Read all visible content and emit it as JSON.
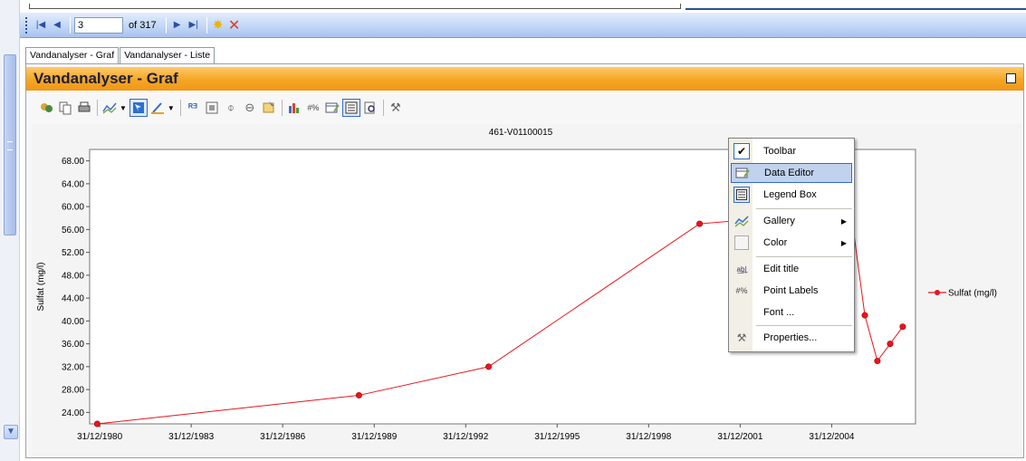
{
  "navigator": {
    "current_record": "3",
    "of_label": "of 317",
    "icons": [
      "move-first-icon",
      "move-previous-icon",
      "move-next-icon",
      "move-last-icon",
      "add-new-icon",
      "delete-icon"
    ]
  },
  "tabs": [
    {
      "label": "Vandanalyser - Graf",
      "active": true
    },
    {
      "label": "Vandanalyser - Liste",
      "active": false
    }
  ],
  "panel": {
    "title": "Vandanalyser - Graf"
  },
  "chart_toolbar_icons": [
    "copy-to-clipboard-icon",
    "copy-icon",
    "print-icon",
    "gallery-icon",
    "color-icon",
    "palette-icon",
    "zoom-icon",
    "grid-icon",
    "vertical-grid-icon",
    "horizontal-grid-icon",
    "export-icon",
    "axis-icon",
    "point-labels-icon",
    "data-editor-icon",
    "legend-box-icon",
    "magnify-icon",
    "properties-icon"
  ],
  "chart_data": {
    "type": "line",
    "title": "461-V01100015",
    "ylabel": "Sulfat (mg/l)",
    "xlabel": "",
    "ylim": [
      22,
      70
    ],
    "yticks": [
      "68.00",
      "64.00",
      "60.00",
      "56.00",
      "52.00",
      "48.00",
      "44.00",
      "40.00",
      "36.00",
      "32.00",
      "28.00",
      "24.00"
    ],
    "xticks": [
      "31/12/1980",
      "31/12/1983",
      "31/12/1986",
      "31/12/1989",
      "31/12/1992",
      "31/12/1995",
      "31/12/1998",
      "31/12/2001",
      "31/12/2004"
    ],
    "grid": false,
    "legend_position": "right",
    "series": [
      {
        "name": "Sulfat (mg/l)",
        "color": "#e8141c",
        "x": [
          "1980-12-01",
          "1989-07-01",
          "1993-10-01",
          "2000-09-01",
          "2001-11-01",
          "2004-06-01",
          "2005-08-01",
          "2006-02-01",
          "2006-07-01",
          "2006-12-01",
          "2007-05-01"
        ],
        "y": [
          22.0,
          27.0,
          32.0,
          57.0,
          57.5,
          69.0,
          61.0,
          41.0,
          33.0,
          36.0,
          39.0
        ]
      }
    ]
  },
  "context_menu": {
    "items": [
      {
        "label": "Toolbar",
        "icon": "check-icon"
      },
      {
        "label": "Data Editor",
        "icon": "data-editor-icon",
        "highlighted": true
      },
      {
        "label": "Legend Box",
        "icon": "legend-box-icon"
      },
      {
        "label": "Gallery",
        "icon": "gallery-icon",
        "submenu": true
      },
      {
        "label": "Color",
        "icon": "color-icon",
        "submenu": true
      },
      {
        "label": "Edit title",
        "icon": "edit-title-icon"
      },
      {
        "label": "Point Labels",
        "icon": "point-labels-icon"
      },
      {
        "label": "Font ...",
        "icon": ""
      },
      {
        "label": "Properties...",
        "icon": "properties-icon"
      }
    ]
  }
}
